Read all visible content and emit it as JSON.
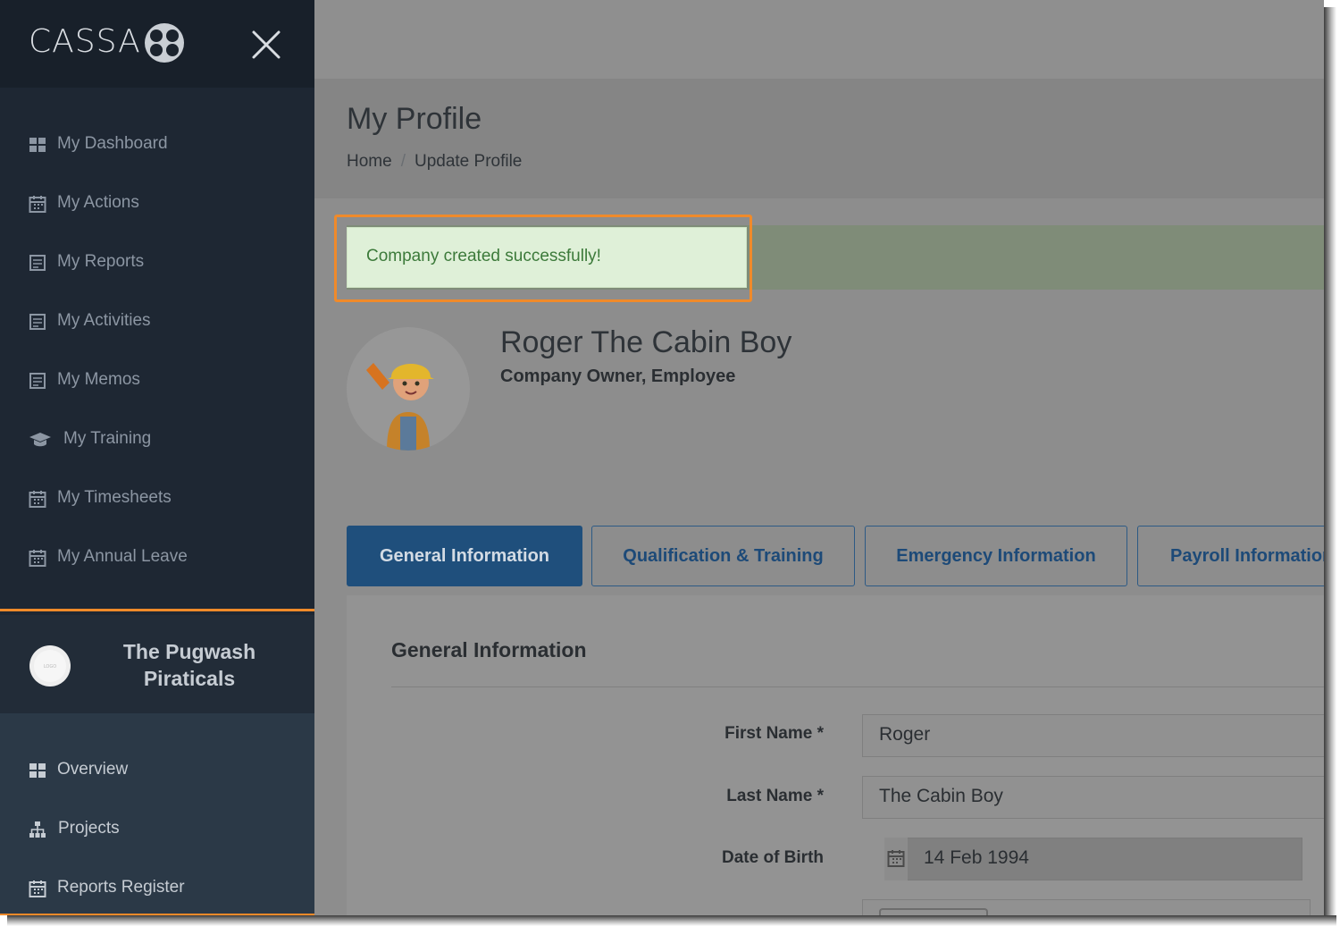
{
  "brand": {
    "name": "CASSA"
  },
  "sidebar": {
    "items": [
      {
        "label": "My Dashboard",
        "icon": "dashboard-icon"
      },
      {
        "label": "My Actions",
        "icon": "calendar-icon"
      },
      {
        "label": "My Reports",
        "icon": "report-icon"
      },
      {
        "label": "My Activities",
        "icon": "report-icon"
      },
      {
        "label": "My Memos",
        "icon": "report-icon"
      },
      {
        "label": "My Training",
        "icon": "graduation-cap-icon"
      },
      {
        "label": "My Timesheets",
        "icon": "calendar-icon"
      },
      {
        "label": "My Annual Leave",
        "icon": "calendar-icon"
      }
    ],
    "company": {
      "name": "The Pugwash Piraticals",
      "logo_text": "LOGO",
      "items": [
        {
          "label": "Overview",
          "icon": "dashboard-icon"
        },
        {
          "label": "Projects",
          "icon": "sitemap-icon"
        },
        {
          "label": "Reports Register",
          "icon": "calendar-icon"
        }
      ]
    }
  },
  "page": {
    "title": "My Profile",
    "breadcrumb": [
      "Home",
      "Update Profile"
    ],
    "alert": "Company created successfully!"
  },
  "profile": {
    "name": "Roger The Cabin Boy",
    "roles": "Company Owner, Employee"
  },
  "tabs": [
    {
      "label": "General Information",
      "active": true
    },
    {
      "label": "Qualification & Training",
      "active": false
    },
    {
      "label": "Emergency Information",
      "active": false
    },
    {
      "label": "Payroll Information",
      "active": false
    }
  ],
  "form": {
    "section_title": "General Information",
    "first_name": {
      "label": "First Name *",
      "value": "Roger"
    },
    "last_name": {
      "label": "Last Name *",
      "value": "The Cabin Boy"
    },
    "dob": {
      "label": "Date of Birth",
      "value": "14 Feb 1994"
    }
  },
  "colors": {
    "highlight": "#f08a2a",
    "primary": "#1f4f7c",
    "success_bg": "#dff0d8",
    "success_text": "#3c7a3a"
  }
}
